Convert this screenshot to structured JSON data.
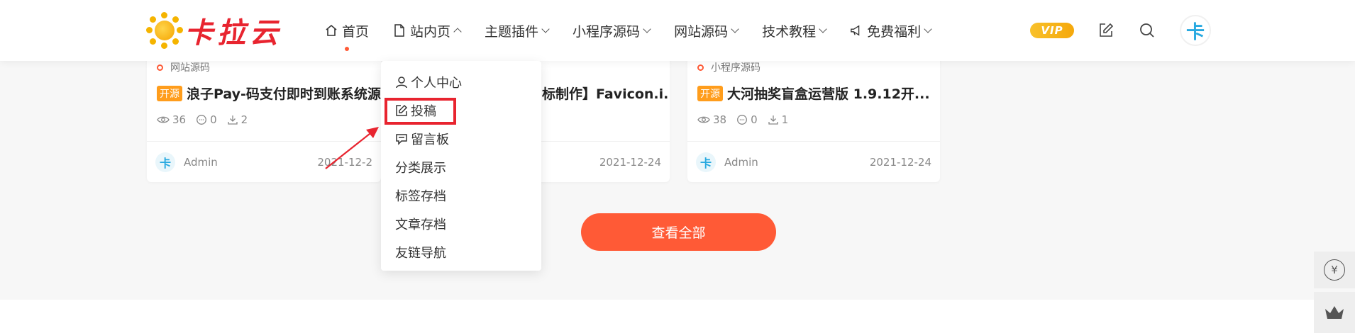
{
  "header": {
    "logo_text": "卡拉云",
    "nav": [
      {
        "label": "首页",
        "icon": "home-icon",
        "active": true
      },
      {
        "label": "站内页",
        "icon": "page-icon",
        "dropdown": true,
        "open": true
      },
      {
        "label": "主题插件",
        "dropdown": true
      },
      {
        "label": "小程序源码",
        "dropdown": true
      },
      {
        "label": "网站源码",
        "dropdown": true
      },
      {
        "label": "技术教程",
        "dropdown": true
      },
      {
        "label": "免费福利",
        "icon": "megaphone-icon",
        "dropdown": true
      }
    ],
    "vip_label": "VIP",
    "avatar_char": "卡"
  },
  "dropdown": {
    "items": [
      {
        "label": "个人中心",
        "icon": "user-icon"
      },
      {
        "label": "投稿",
        "icon": "edit-icon",
        "highlighted": true
      },
      {
        "label": "留言板",
        "icon": "comment-icon"
      },
      {
        "label": "分类展示"
      },
      {
        "label": "标签存档"
      },
      {
        "label": "文章存档"
      },
      {
        "label": "友链导航"
      }
    ]
  },
  "cards": [
    {
      "category": "网站源码",
      "badge": "开源",
      "title": "浪子Pay-码支付即时到账系统源...",
      "views": "36",
      "comments": "0",
      "downloads": "2",
      "author": "Admin",
      "date": "2021-12-2"
    },
    {
      "category": "",
      "badge": "",
      "title": "标制作】Favicon.i...",
      "views": "",
      "comments": "",
      "downloads": "",
      "author": "",
      "date": "2021-12-24"
    },
    {
      "category": "小程序源码",
      "badge": "开源",
      "title": "大河抽奖盲盒运营版 1.9.12开...",
      "views": "38",
      "comments": "0",
      "downloads": "1",
      "author": "Admin",
      "date": "2021-12-24"
    }
  ],
  "view_all_label": "查看全部",
  "float_buttons": [
    {
      "icon": "yen-icon",
      "label": "¥"
    },
    {
      "icon": "crown-icon"
    }
  ],
  "colors": {
    "accent": "#ff5a36",
    "badge": "#ff9d1c",
    "logo_red": "#e8242f",
    "vip": "#f5a80b"
  }
}
